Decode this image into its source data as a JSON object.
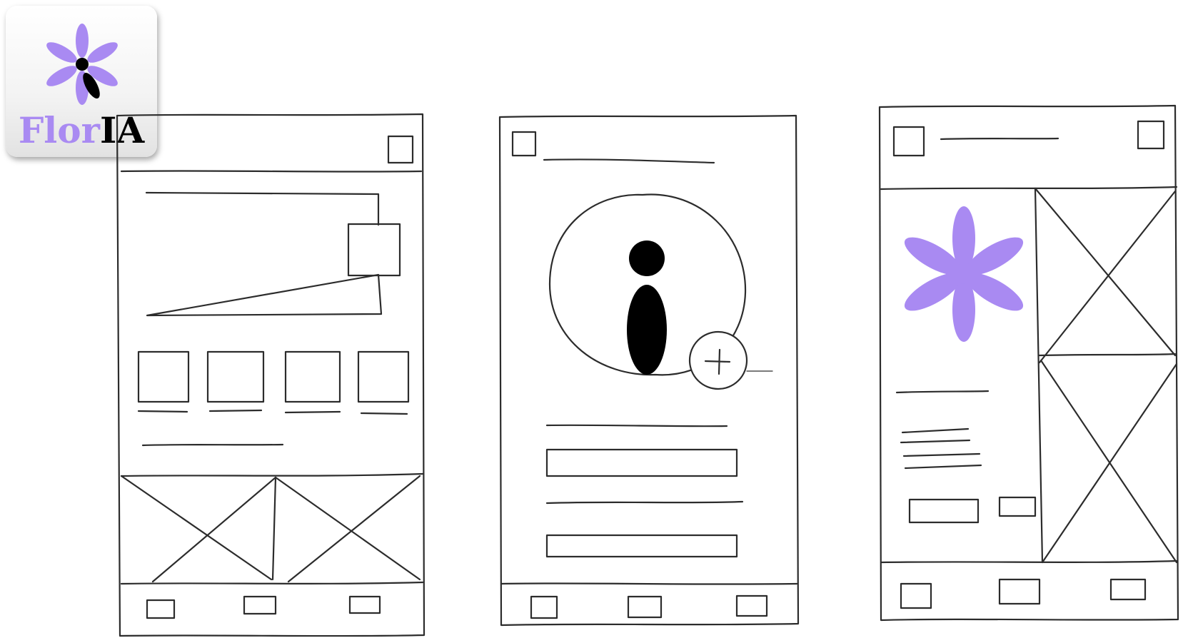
{
  "brand": {
    "name_part1": "Flor",
    "name_part2": "IA",
    "flower_icon": "flower-icon",
    "accent_color": "#a98af2",
    "dark_color": "#000000"
  },
  "screens": [
    {
      "id": "home",
      "icons": [
        "menu-box-icon",
        "image-placeholder-icon"
      ]
    },
    {
      "id": "profile",
      "icons": [
        "info-icon",
        "add-icon"
      ]
    },
    {
      "id": "detail",
      "icons": [
        "flower-icon",
        "image-placeholder-icon"
      ]
    }
  ]
}
